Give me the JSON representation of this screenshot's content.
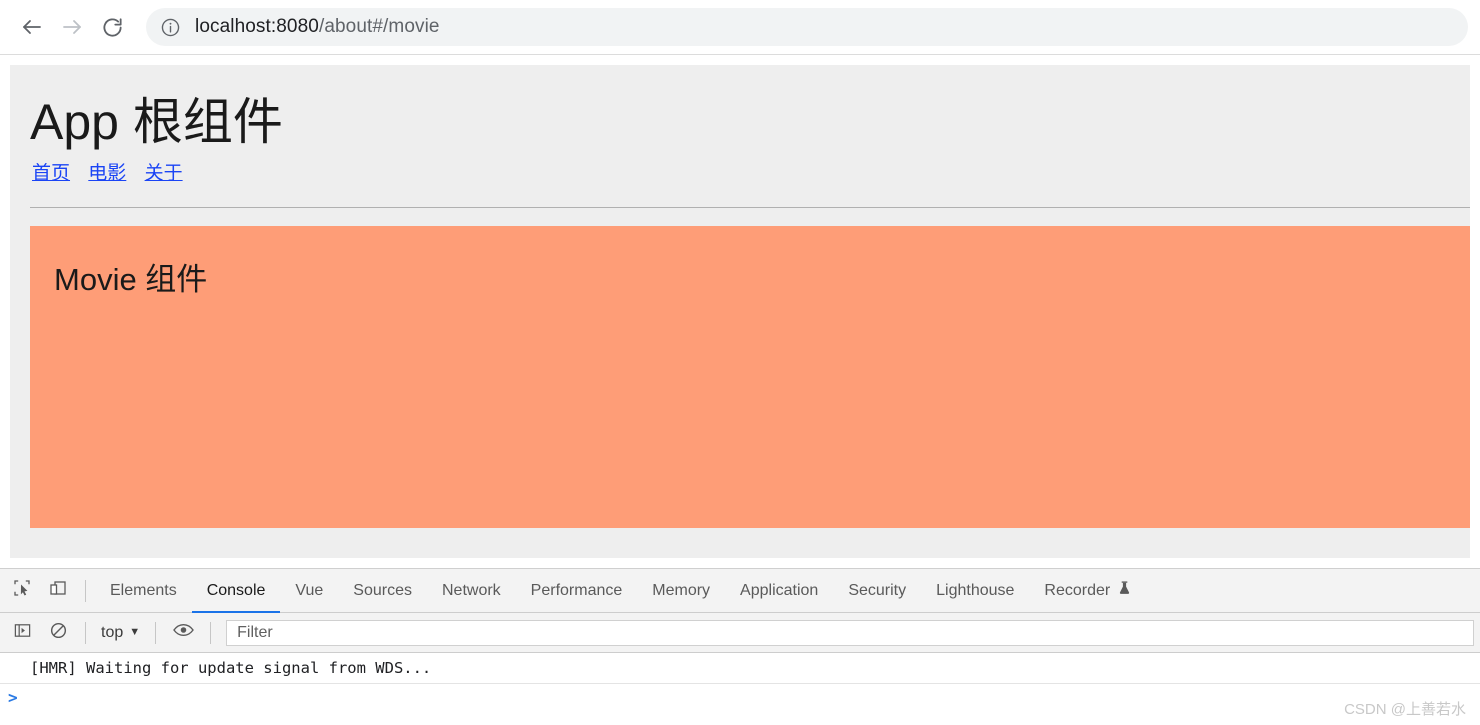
{
  "browser": {
    "back_icon": "arrow-left-icon",
    "forward_icon": "arrow-right-icon",
    "reload_icon": "reload-icon",
    "site_info_icon": "info-circle-icon",
    "url_host": "localhost:8080",
    "url_path": "/about#/movie",
    "url_full": "localhost:8080/about#/movie"
  },
  "page": {
    "title": "App 根组件",
    "nav_links": [
      {
        "label": "首页"
      },
      {
        "label": "电影"
      },
      {
        "label": "关于"
      }
    ],
    "component": {
      "heading": "Movie 组件",
      "background_color": "#fe9d77"
    },
    "page_background": "#eeeeee"
  },
  "devtools": {
    "inspect_icon": "inspect-element-icon",
    "device_toolbar_icon": "device-toolbar-icon",
    "tabs": [
      {
        "label": "Elements",
        "active": false
      },
      {
        "label": "Console",
        "active": true
      },
      {
        "label": "Vue",
        "active": false
      },
      {
        "label": "Sources",
        "active": false
      },
      {
        "label": "Network",
        "active": false
      },
      {
        "label": "Performance",
        "active": false
      },
      {
        "label": "Memory",
        "active": false
      },
      {
        "label": "Application",
        "active": false
      },
      {
        "label": "Security",
        "active": false
      },
      {
        "label": "Lighthouse",
        "active": false
      },
      {
        "label": "Recorder",
        "active": false,
        "icon": "flask-icon"
      }
    ],
    "active_tab_accent": "#1a73e8",
    "toolbar": {
      "sidebar_icon": "console-sidebar-icon",
      "clear_icon": "clear-console-icon",
      "context_label": "top",
      "context_caret": "▼",
      "eye_icon": "live-expression-eye-icon",
      "filter_placeholder": "Filter",
      "filter_value": ""
    },
    "console": {
      "messages": [
        {
          "text": "[HMR] Waiting for update signal from WDS..."
        }
      ],
      "prompt_symbol": ">",
      "prompt_value": ""
    }
  },
  "watermark": {
    "text": "CSDN @上善若水"
  }
}
